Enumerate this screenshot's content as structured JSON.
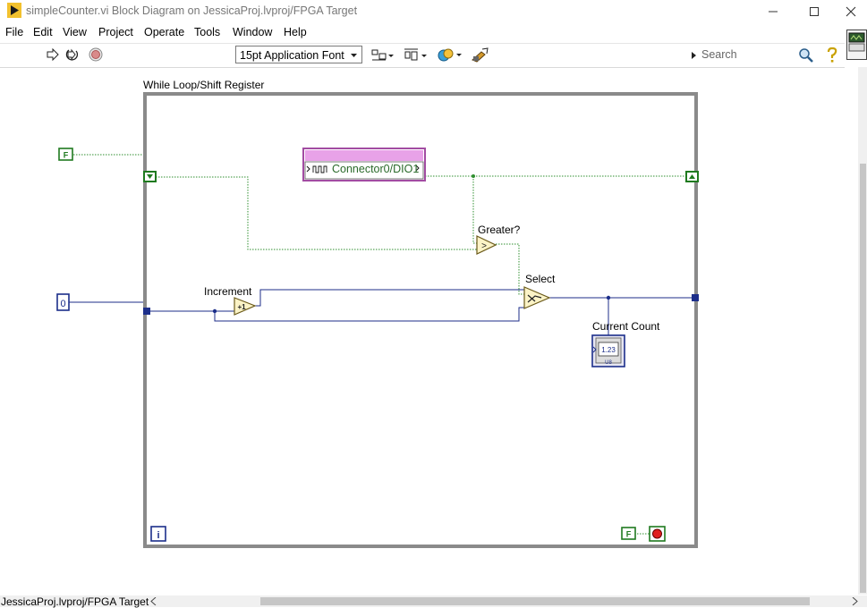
{
  "window": {
    "title": "simpleCounter.vi Block Diagram on JessicaProj.lvproj/FPGA Target"
  },
  "menu": [
    "File",
    "Edit",
    "View",
    "Project",
    "Operate",
    "Tools",
    "Window",
    "Help"
  ],
  "toolbar": {
    "font": "15pt Application Font",
    "search_placeholder": "Search"
  },
  "diagram": {
    "loop_label": "While Loop/Shift Register",
    "increment_label": "Increment",
    "increment_symbol": "+1",
    "greater_label": "Greater?",
    "greater_symbol": ">",
    "select_label": "Select",
    "indicator_label": "Current Count",
    "indicator_value": "1.23",
    "indicator_type": "U8",
    "io_node": "Connector0/DIO1",
    "false_constant": "F",
    "zero_constant": "0",
    "iteration_terminal": "i",
    "stop_constant": "F"
  },
  "status_bar": {
    "target": "JessicaProj.lvproj/FPGA Target"
  },
  "colors": {
    "boolean_wire": "#2f8f2f",
    "numeric_wire": "#1c2e8a",
    "loop_border": "#8a8a8a",
    "io_node": "#a24ca2"
  }
}
